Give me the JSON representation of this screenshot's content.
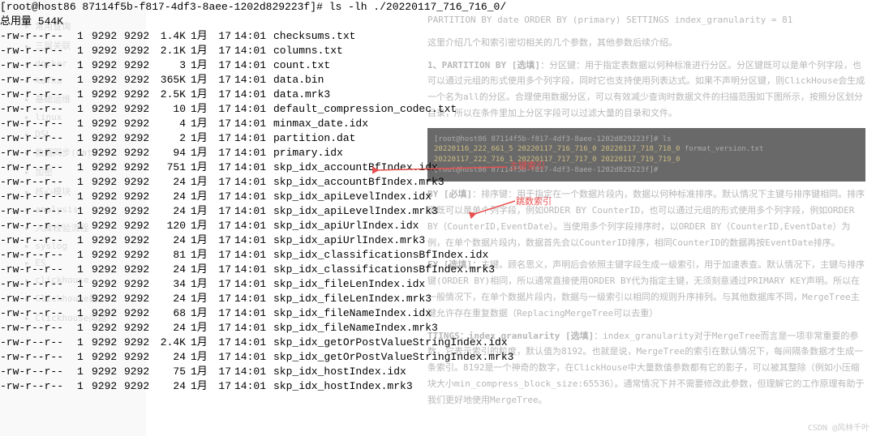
{
  "sidebar": {
    "items": [
      {
        "label": "常用查询"
      },
      {
        "label": "三层关联"
      },
      {
        "label": "docker"
      },
      {
        "label": "kafka"
      },
      {
        "label": "基础运维"
      },
      {
        "label": "linux"
      },
      {
        "label": "DSL"
      },
      {
        "label": "数据同步(data)"
      },
      {
        "label": "加密"
      },
      {
        "label": "核心模块"
      },
      {
        "label": "analysis"
      },
      {
        "label": "入库校验流程"
      },
      {
        "label": "syslog"
      },
      {
        "label": "ES"
      },
      {
        "label": "clickhouse"
      },
      {
        "label": "Clickhouse数…"
      },
      {
        "label": "Clickhouse问题"
      }
    ]
  },
  "terminal": {
    "prompt": "[root@host86 87114f5b-f817-4df3-8aee-1202d829223f]#",
    "command": "ls -lh ./20220117_716_716_0/",
    "total": "总用量 544K",
    "rows": [
      {
        "perm": "-rw-r--r--",
        "ln": "1",
        "o": "9292",
        "g": "9292",
        "sz": "1.4K",
        "m": "1月",
        "d": "17",
        "t": "14:01",
        "n": "checksums.txt"
      },
      {
        "perm": "-rw-r--r--",
        "ln": "1",
        "o": "9292",
        "g": "9292",
        "sz": "2.1K",
        "m": "1月",
        "d": "17",
        "t": "14:01",
        "n": "columns.txt"
      },
      {
        "perm": "-rw-r--r--",
        "ln": "1",
        "o": "9292",
        "g": "9292",
        "sz": "3",
        "m": "1月",
        "d": "17",
        "t": "14:01",
        "n": "count.txt"
      },
      {
        "perm": "-rw-r--r--",
        "ln": "1",
        "o": "9292",
        "g": "9292",
        "sz": "365K",
        "m": "1月",
        "d": "17",
        "t": "14:01",
        "n": "data.bin"
      },
      {
        "perm": "-rw-r--r--",
        "ln": "1",
        "o": "9292",
        "g": "9292",
        "sz": "2.5K",
        "m": "1月",
        "d": "17",
        "t": "14:01",
        "n": "data.mrk3"
      },
      {
        "perm": "-rw-r--r--",
        "ln": "1",
        "o": "9292",
        "g": "9292",
        "sz": "10",
        "m": "1月",
        "d": "17",
        "t": "14:01",
        "n": "default_compression_codec.txt"
      },
      {
        "perm": "-rw-r--r--",
        "ln": "1",
        "o": "9292",
        "g": "9292",
        "sz": "4",
        "m": "1月",
        "d": "17",
        "t": "14:01",
        "n": "minmax_date.idx"
      },
      {
        "perm": "-rw-r--r--",
        "ln": "1",
        "o": "9292",
        "g": "9292",
        "sz": "2",
        "m": "1月",
        "d": "17",
        "t": "14:01",
        "n": "partition.dat"
      },
      {
        "perm": "-rw-r--r--",
        "ln": "1",
        "o": "9292",
        "g": "9292",
        "sz": "94",
        "m": "1月",
        "d": "17",
        "t": "14:01",
        "n": "primary.idx"
      },
      {
        "perm": "-rw-r--r--",
        "ln": "1",
        "o": "9292",
        "g": "9292",
        "sz": "751",
        "m": "1月",
        "d": "17",
        "t": "14:01",
        "n": "skp_idx_accountBfIndex.idx"
      },
      {
        "perm": "-rw-r--r--",
        "ln": "1",
        "o": "9292",
        "g": "9292",
        "sz": "24",
        "m": "1月",
        "d": "17",
        "t": "14:01",
        "n": "skp_idx_accountBfIndex.mrk3"
      },
      {
        "perm": "-rw-r--r--",
        "ln": "1",
        "o": "9292",
        "g": "9292",
        "sz": "24",
        "m": "1月",
        "d": "17",
        "t": "14:01",
        "n": "skp_idx_apiLevelIndex.idx"
      },
      {
        "perm": "-rw-r--r--",
        "ln": "1",
        "o": "9292",
        "g": "9292",
        "sz": "24",
        "m": "1月",
        "d": "17",
        "t": "14:01",
        "n": "skp_idx_apiLevelIndex.mrk3"
      },
      {
        "perm": "-rw-r--r--",
        "ln": "1",
        "o": "9292",
        "g": "9292",
        "sz": "120",
        "m": "1月",
        "d": "17",
        "t": "14:01",
        "n": "skp_idx_apiUrlIndex.idx"
      },
      {
        "perm": "-rw-r--r--",
        "ln": "1",
        "o": "9292",
        "g": "9292",
        "sz": "24",
        "m": "1月",
        "d": "17",
        "t": "14:01",
        "n": "skp_idx_apiUrlIndex.mrk3"
      },
      {
        "perm": "-rw-r--r--",
        "ln": "1",
        "o": "9292",
        "g": "9292",
        "sz": "81",
        "m": "1月",
        "d": "17",
        "t": "14:01",
        "n": "skp_idx_classificationsBfIndex.idx"
      },
      {
        "perm": "-rw-r--r--",
        "ln": "1",
        "o": "9292",
        "g": "9292",
        "sz": "24",
        "m": "1月",
        "d": "17",
        "t": "14:01",
        "n": "skp_idx_classificationsBfIndex.mrk3"
      },
      {
        "perm": "-rw-r--r--",
        "ln": "1",
        "o": "9292",
        "g": "9292",
        "sz": "34",
        "m": "1月",
        "d": "17",
        "t": "14:01",
        "n": "skp_idx_fileLenIndex.idx"
      },
      {
        "perm": "-rw-r--r--",
        "ln": "1",
        "o": "9292",
        "g": "9292",
        "sz": "24",
        "m": "1月",
        "d": "17",
        "t": "14:01",
        "n": "skp_idx_fileLenIndex.mrk3"
      },
      {
        "perm": "-rw-r--r--",
        "ln": "1",
        "o": "9292",
        "g": "9292",
        "sz": "68",
        "m": "1月",
        "d": "17",
        "t": "14:01",
        "n": "skp_idx_fileNameIndex.idx"
      },
      {
        "perm": "-rw-r--r--",
        "ln": "1",
        "o": "9292",
        "g": "9292",
        "sz": "24",
        "m": "1月",
        "d": "17",
        "t": "14:01",
        "n": "skp_idx_fileNameIndex.mrk3"
      },
      {
        "perm": "-rw-r--r--",
        "ln": "1",
        "o": "9292",
        "g": "9292",
        "sz": "2.4K",
        "m": "1月",
        "d": "17",
        "t": "14:01",
        "n": "skp_idx_getOrPostValueStringIndex.idx"
      },
      {
        "perm": "-rw-r--r--",
        "ln": "1",
        "o": "9292",
        "g": "9292",
        "sz": "24",
        "m": "1月",
        "d": "17",
        "t": "14:01",
        "n": "skp_idx_getOrPostValueStringIndex.mrk3"
      },
      {
        "perm": "-rw-r--r--",
        "ln": "1",
        "o": "9292",
        "g": "9292",
        "sz": "75",
        "m": "1月",
        "d": "17",
        "t": "14:01",
        "n": "skp_idx_hostIndex.idx"
      },
      {
        "perm": "-rw-r--r--",
        "ln": "1",
        "o": "9292",
        "g": "9292",
        "sz": "24",
        "m": "1月",
        "d": "17",
        "t": "14:01",
        "n": "skp_idx_hostIndex.mrk3"
      }
    ]
  },
  "bgRight": {
    "topline": "PARTITION BY date ORDER BY (primary) SETTINGS index_granularity = 81",
    "intro": "这里介绍几个和索引密切相关的几个参数，其他参数后续介绍。",
    "p1_title": "1、PARTITION BY [选填]",
    "p1": "：分区键：用于指定表数据以何种标准进行分区。分区键既可以是单个列字段，也可以通过元组的形式使用多个列字段，同时它也支持使用列表达式。如果不声明分区键，则ClickHouse会生成一个名为all的分区。合理使用数据分区，可以有效减少查询时数据文件的扫描范围如下图所示，按照分区划分目录，所以在条件里加上分区字段可以过滤大量的目录和文件。",
    "dark1": "[root@host86 87114f5b-f817-4df3-8aee-1202d829223f]# ls",
    "dark2": "[root@host86 87114f5b-f817-4df3-8aee-1202d829223f]#",
    "darkfile": "format_version.txt",
    "p2_title": "BY [必填]",
    "p2": "：排序键：用于指定在一个数据片段内，数据以何种标准排序。默认情况下主键与排序键相同。排序键既可以是单个列字段，例如ORDER BY CounterID，也可以通过元组的形式使用多个列字段，例如ORDER BY（CounterID,EventDate）。当使用多个列字段排序时，以ORDER BY（CounterID,EventDate）为例，在单个数据片段内，数据首先会以CounterID排序，相同CounterID的数据再按EventDate排序。",
    "p3_title": "EY [选填]：",
    "p3": "主键。顾名思义，声明后会依照主键字段生成一级索引，用于加速表查。默认情况下，主键与排序键(ORDER BY)相同，所以通常直接使用ORDER BY代为指定主键，无须刻意通过PRIMARY KEY声明。所以在一般情况下，在单个数据片段内，数据与一级索引以相同的规则升序排列。与其他数据库不同，MergeTree主键允许存在重复数据（ReplacingMergeTree可以去重）",
    "p4_title": "TTINGS：index_granularity [选填]",
    "p4": "：index_granularity对于MergeTree而言是一项非常重要的参数，它表示索引的粒度，默认值为8192。也就是说，MergeTree的索引在默认情况下，每间隔条数据才生成一条索引。8192是一个神奇的数字，在ClickHouse中大量数值参数都有它的影子，可以被其整除（例如小压缩块大小min_compress_block_size:65536）。通常情况下并不需要修改此参数，但理解它的工作原理有助于我们更好地使用MergeTree。"
  },
  "annotations": {
    "a1": "主键索引",
    "a2": "跳数索引"
  },
  "watermark": "CSDN @风林千叶"
}
